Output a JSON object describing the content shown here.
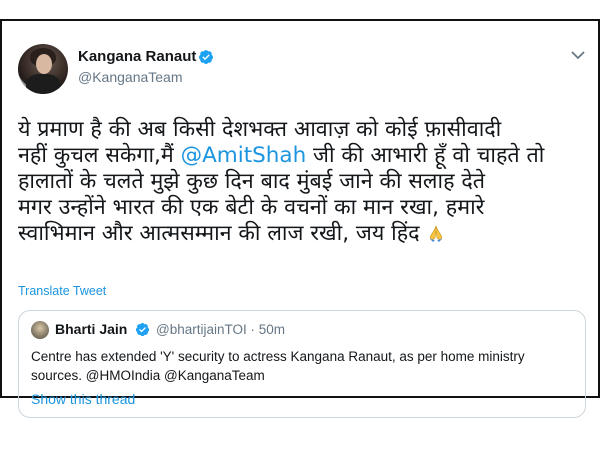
{
  "tweet": {
    "author_name": "Kangana Ranaut",
    "author_handle": "@KanganaTeam",
    "body_lines": [
      "ये प्रमाण है की अब किसी देशभक्त आवाज़ को कोई फ़ासीवादी",
      "नहीं कुचल सकेगा,मैं ",
      "हालातों के चलते मुझे कुछ दिन बाद मुंबई जाने की सलाह देते",
      "मगर उन्होंने भारत की एक बेटी के वचनों का मान रखा, हमारे",
      "स्वाभिमान और आत्मसम्मान की लाज रखी, जय हिंद"
    ],
    "mention": "@AmitShah",
    "line2_tail": " जी की आभारी हूँ वो चाहते तो",
    "translate_label": "Translate Tweet"
  },
  "quote": {
    "author_name": "Bharti Jain",
    "author_handle_time": "@bhartijainTOI · 50m",
    "text_lines": [
      "Centre has extended 'Y' security to actress Kangana Ranaut, as per home ministry",
      "sources. @HMOIndia @KanganaTeam"
    ],
    "show_thread_label": "Show this thread"
  },
  "icons": {
    "verified": "verified-badge-icon",
    "more": "chevron-down-icon",
    "emoji": "folded-hands-emoji-icon"
  },
  "colors": {
    "link": "#1b95e0",
    "verified": "#1da1f2",
    "muted": "#657786"
  }
}
